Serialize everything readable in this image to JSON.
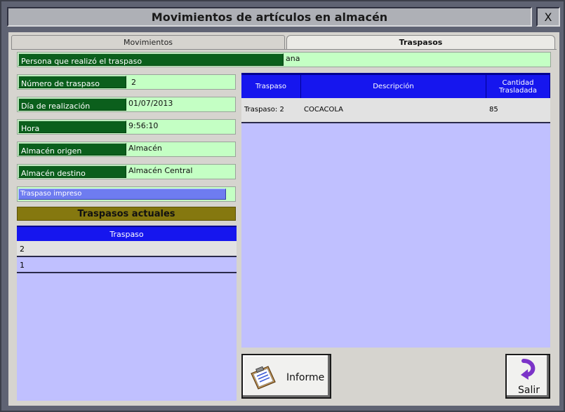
{
  "window": {
    "title": "Movimientos de artículos en almacén",
    "close_label": "X"
  },
  "tabs": [
    {
      "label": "Movimientos",
      "active": false
    },
    {
      "label": "Traspasos",
      "active": true
    }
  ],
  "person": {
    "label": "Persona que realizó el traspaso",
    "value": "ana"
  },
  "fields": {
    "numero": {
      "label": "Número de traspaso",
      "value": "2"
    },
    "dia": {
      "label": "Día de realización",
      "value": "01/07/2013"
    },
    "hora": {
      "label": "Hora",
      "value": "9:56:10"
    },
    "origen": {
      "label": "Almacén origen",
      "value": "Almacén"
    },
    "destino": {
      "label": "Almacén destino",
      "value": "Almacén Central"
    }
  },
  "impreso": {
    "label": "Traspaso impreso",
    "progress": 0.96
  },
  "actuales": {
    "title": "Traspasos actuales",
    "column": "Traspaso",
    "rows": [
      "2",
      "1"
    ]
  },
  "detalle": {
    "columns": [
      "Traspaso",
      "Descripción",
      "Cantidad Trasladada"
    ],
    "rows": [
      {
        "traspaso": "Traspaso: 2",
        "descripcion": "COCACOLA",
        "cantidad": "85"
      }
    ]
  },
  "buttons": {
    "informe": "Informe",
    "salir": "Salir"
  },
  "colors": {
    "label_green": "#0b5f1c",
    "field_green": "#c4ffc4",
    "header_blue": "#1616ee",
    "list_lavender": "#c0c0ff",
    "section_olive": "#85780f"
  }
}
